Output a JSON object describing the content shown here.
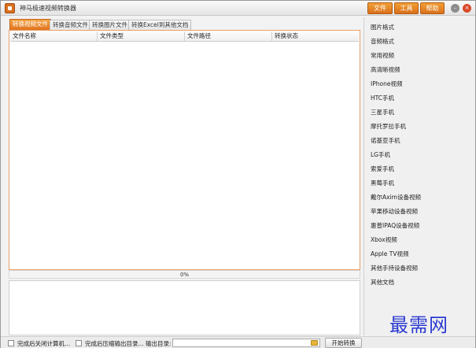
{
  "window": {
    "title": "神马极速视频转换器"
  },
  "menu": {
    "file": "文件",
    "tools": "工具",
    "help": "帮助"
  },
  "tabs": [
    {
      "label": "转换视频文件"
    },
    {
      "label": "转换音频文件"
    },
    {
      "label": "转换图片文件"
    },
    {
      "label": "转换Excel到其他文档"
    }
  ],
  "table": {
    "columns": [
      "文件名称",
      "文件类型",
      "文件路径",
      "转换状态"
    ]
  },
  "progress": {
    "value": 0,
    "label": "0%"
  },
  "sidebar": {
    "items": [
      "图片格式",
      "音频格式",
      "常用视频",
      "高清晰视频",
      "IPhone视频",
      "HTC手机",
      "三星手机",
      "摩托罗拉手机",
      "诺基亚手机",
      "LG手机",
      "索爱手机",
      "黑莓手机",
      "戴尔Axim设备视频",
      "苹果移动设备视频",
      "惠普IPAQ设备视频",
      "Xbox视频",
      "Apple TV视频",
      "其他手持设备视频",
      "其他文档"
    ]
  },
  "bottom": {
    "shutdown_label": "完成后关闭计算机...",
    "open_folder_label": "完成后压缩输出目录...",
    "output_dir_label": "输出目录:",
    "output_dir_value": "",
    "start_label": "开始转换"
  },
  "watermark": "最需网"
}
